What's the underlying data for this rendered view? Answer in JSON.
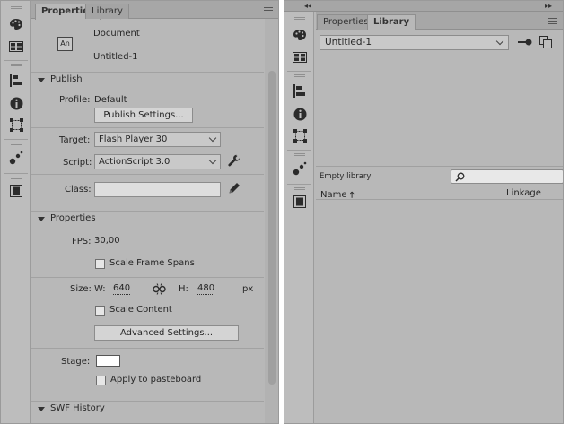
{
  "left_panel": {
    "tabs": [
      {
        "label": "Properties",
        "active": true
      },
      {
        "label": "Library",
        "active": false
      }
    ],
    "document": {
      "badge": "An",
      "type_label": "Document",
      "name": "Untitled-1"
    },
    "publish": {
      "title": "Publish",
      "profile_label": "Profile:",
      "profile_value": "Default",
      "settings_button": "Publish Settings...",
      "target_label": "Target:",
      "target_value": "Flash Player 30",
      "script_label": "Script:",
      "script_value": "ActionScript 3.0",
      "class_label": "Class:",
      "class_value": ""
    },
    "properties": {
      "title": "Properties",
      "fps_label": "FPS:",
      "fps_value": "30,00",
      "scale_frame_spans": "Scale Frame Spans",
      "size_label": "Size:",
      "w_label": "W:",
      "w_value": "640",
      "h_label": "H:",
      "h_value": "480",
      "unit": "px",
      "scale_content": "Scale Content",
      "advanced_button": "Advanced Settings...",
      "stage_label": "Stage:",
      "stage_color": "#ffffff",
      "apply_pasteboard": "Apply to pasteboard"
    },
    "swf_history": {
      "title": "SWF History"
    }
  },
  "right_panel": {
    "tabs": [
      {
        "label": "Properties",
        "active": false
      },
      {
        "label": "Library",
        "active": true
      }
    ],
    "document_dropdown": "Untitled-1",
    "empty_label": "Empty library",
    "search_placeholder": "",
    "columns": {
      "name": "Name",
      "sort_indicator": "🡑",
      "linkage": "Linkage"
    }
  },
  "tool_icons": [
    "color-palette-icon",
    "swatches-icon",
    "align-icon",
    "info-icon",
    "transform-icon",
    "motion-presets-icon",
    "library-book-icon"
  ],
  "colors": {
    "panel_bg": "#b8b8b8",
    "tab_bar_bg": "#a7a7a7",
    "stage_color": "#ffffff"
  }
}
